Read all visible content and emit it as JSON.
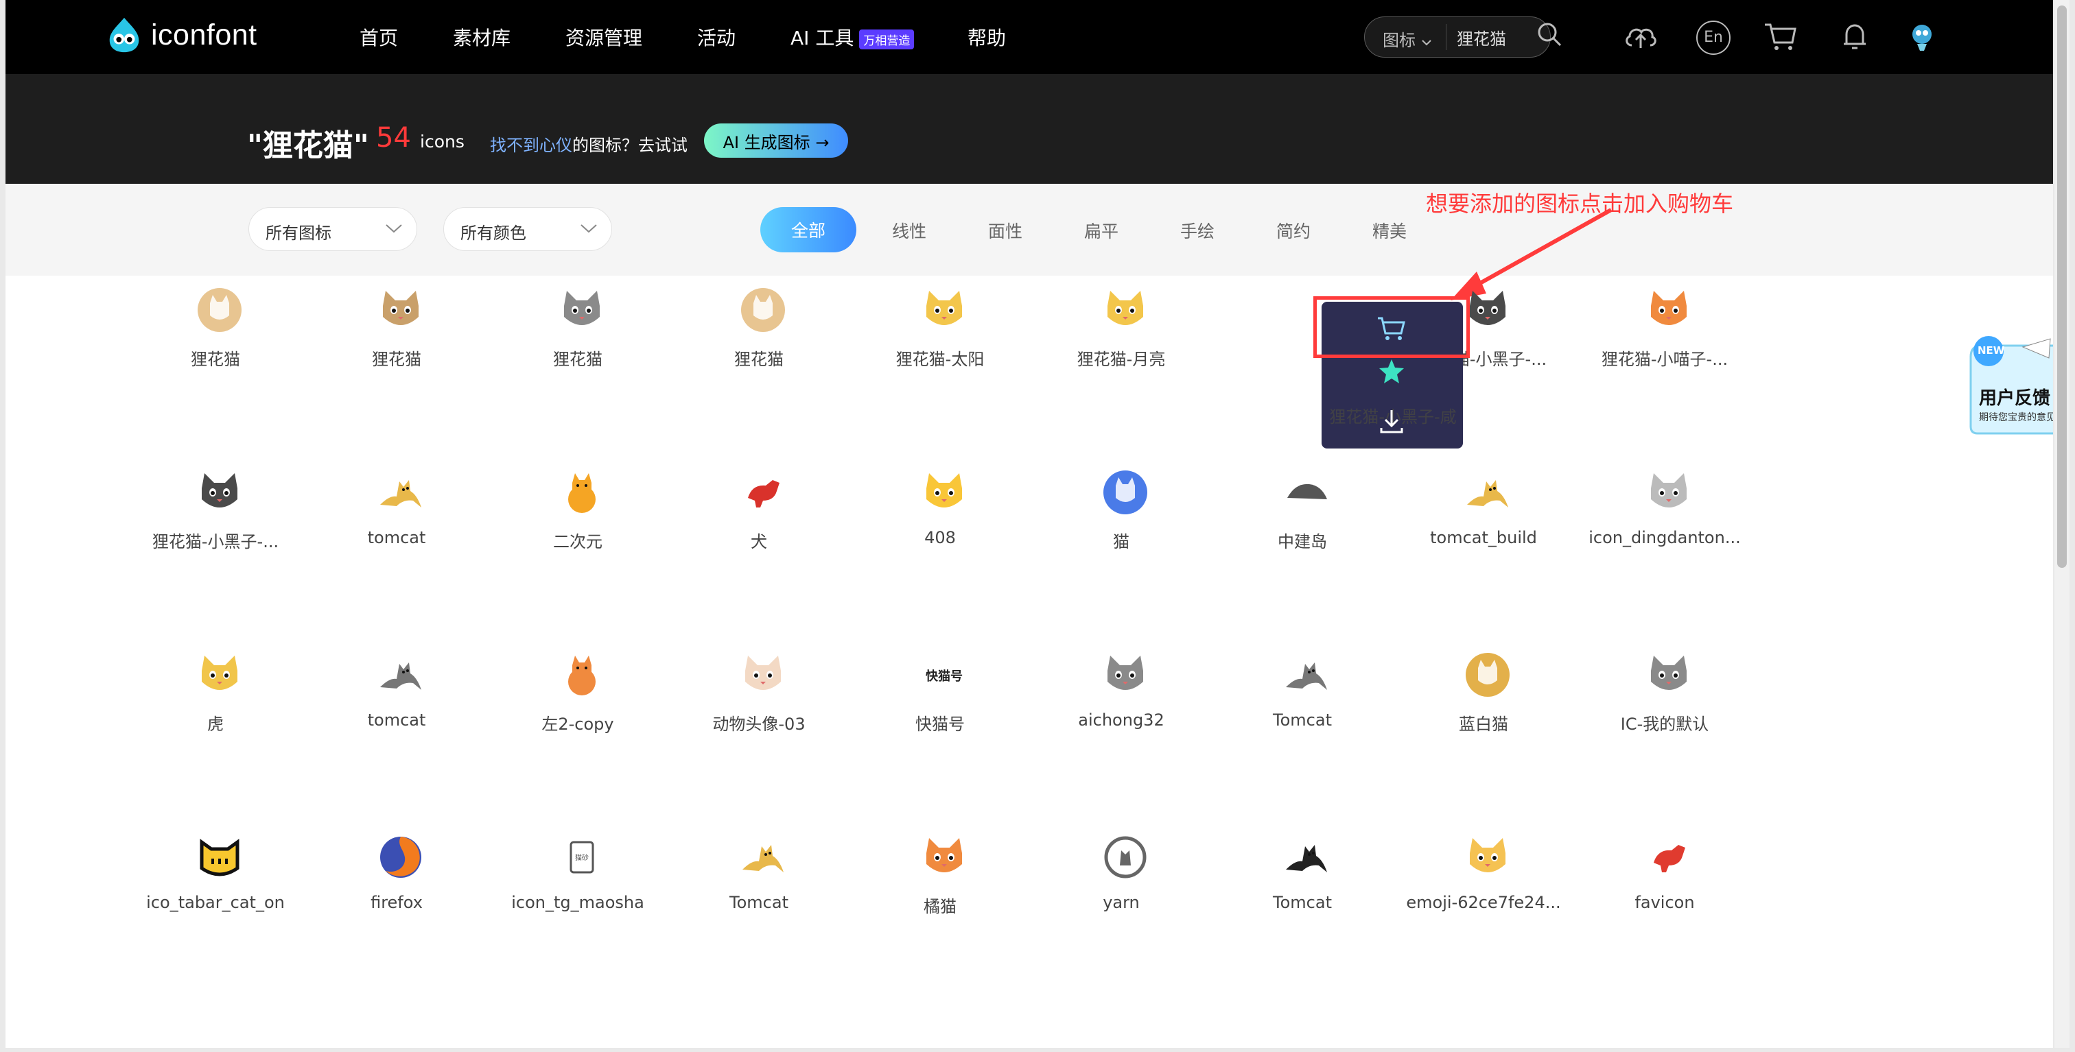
{
  "app": {
    "logo_text": "iconfont"
  },
  "nav": {
    "items": [
      "首页",
      "素材库",
      "资源管理",
      "活动",
      "AI 工具",
      "帮助"
    ],
    "ai_badge": "万相营造",
    "search_type": "图标",
    "search_value": "狸花猫",
    "lang": "En"
  },
  "banner": {
    "query": "\"狸花猫\"",
    "count": "54",
    "count_unit": "icons",
    "hint_highlight": "找不到心仪",
    "hint_rest": "的图标？去试试",
    "ai_button": "AI 生成图标 →"
  },
  "filters": {
    "dropdown_icons": "所有图标",
    "dropdown_colors": "所有颜色",
    "tabs": [
      "全部",
      "线性",
      "面性",
      "扁平",
      "手绘",
      "简约",
      "精美"
    ],
    "active_tab": "全部"
  },
  "annotation": "想要添加的图标点击加入购物车",
  "hover_label": "狸花猫-小黑子-咸",
  "feedback": {
    "title": "用户反馈",
    "subtitle": "期待您宝贵的意见",
    "badge": "NEW"
  },
  "icons": [
    {
      "label": "狸花猫",
      "icon": "cat-face-round-icon"
    },
    {
      "label": "狸花猫",
      "icon": "tabby-cat-face-icon"
    },
    {
      "label": "狸花猫",
      "icon": "gray-cat-face-icon"
    },
    {
      "label": "狸花猫",
      "icon": "cat-face-round-icon"
    },
    {
      "label": "狸花猫-太阳",
      "icon": "cat-sun-icon"
    },
    {
      "label": "狸花猫-月亮",
      "icon": "cat-moon-icon"
    },
    {
      "label": "狸花猫-小黑子-咸",
      "icon": "cat-star-icon"
    },
    {
      "label": "狸花猫-小黑子-...",
      "icon": "black-cat-face-icon"
    },
    {
      "label": "狸花猫-小喵子-...",
      "icon": "orange-cat-face-icon"
    },
    {
      "label": "狸花猫-小黑子-...",
      "icon": "black-cat-face-icon"
    },
    {
      "label": "tomcat",
      "icon": "tomcat-icon"
    },
    {
      "label": "二次元",
      "icon": "orange-cat-sitting-icon"
    },
    {
      "label": "犬",
      "icon": "red-dog-icon"
    },
    {
      "label": "408",
      "icon": "crying-cat-emoji-icon"
    },
    {
      "label": "猫",
      "icon": "cat-circle-blue-icon"
    },
    {
      "label": "中建岛",
      "icon": "island-icon"
    },
    {
      "label": "tomcat_build",
      "icon": "tomcat-icon"
    },
    {
      "label": "icon_dingdanton...",
      "icon": "cart-cat-icon"
    },
    {
      "label": "虎",
      "icon": "tiger-icon"
    },
    {
      "label": "tomcat",
      "icon": "tomcat-gray-icon"
    },
    {
      "label": "左2-copy",
      "icon": "orange-cat-ball-icon"
    },
    {
      "label": "动物头像-03",
      "icon": "cat-avatar-icon"
    },
    {
      "label": "快猫号",
      "icon": "kuaimao-text-icon"
    },
    {
      "label": "aichong32",
      "icon": "gray-cat-face-icon"
    },
    {
      "label": "Tomcat",
      "icon": "tomcat-gray-icon"
    },
    {
      "label": "蓝白猫",
      "icon": "blue-white-cat-icon"
    },
    {
      "label": "IC-我的默认",
      "icon": "gray-cat-face-icon"
    },
    {
      "label": "ico_tabar_cat_on",
      "icon": "yellow-cat-outline-icon"
    },
    {
      "label": "firefox",
      "icon": "firefox-icon"
    },
    {
      "label": "icon_tg_maosha",
      "icon": "cat-litter-bag-icon"
    },
    {
      "label": "Tomcat",
      "icon": "tomcat-icon"
    },
    {
      "label": "橘猫",
      "icon": "orange-cat-face-icon"
    },
    {
      "label": "yarn",
      "icon": "yarn-cat-icon"
    },
    {
      "label": "Tomcat",
      "icon": "tomcat-black-icon"
    },
    {
      "label": "emoji-62ce7fe24...",
      "icon": "yellow-cat-emoji-icon"
    },
    {
      "label": "favicon",
      "icon": "red-cat-icon"
    }
  ]
}
